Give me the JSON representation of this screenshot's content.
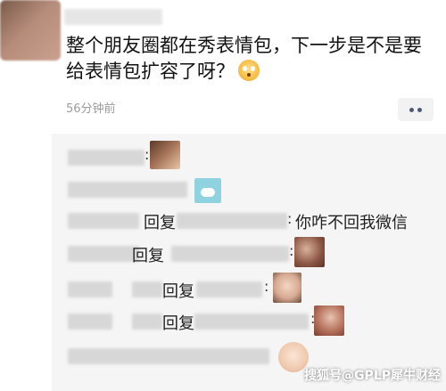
{
  "post": {
    "text": "整个朋友圈都在秀表情包，下一步是不是要给表情包扩容了呀？",
    "emoji_icon": "flushed-face-emoji",
    "timestamp": "56分钟前"
  },
  "more_button": {
    "icon": "ellipsis-icon"
  },
  "comments": [
    {
      "type": "comment",
      "colon": ":",
      "sticker": "photo-sticker"
    },
    {
      "type": "comment",
      "sticker": "cartoon-sticker"
    },
    {
      "type": "reply",
      "reply_label": "回复",
      "colon": ":",
      "text": "你咋不回我微信"
    },
    {
      "type": "reply",
      "reply_label": "回复",
      "colon": ":",
      "sticker": "photo-sticker"
    },
    {
      "type": "reply",
      "reply_label": "回复",
      "colon": ":",
      "sticker": "baby-photo-sticker"
    },
    {
      "type": "reply",
      "reply_label": "回复",
      "colon": ":",
      "sticker": "photo-sticker"
    },
    {
      "type": "comment",
      "sticker": "baby-photo-sticker"
    }
  ],
  "watermark": "搜狐号@GPLP犀牛财经"
}
